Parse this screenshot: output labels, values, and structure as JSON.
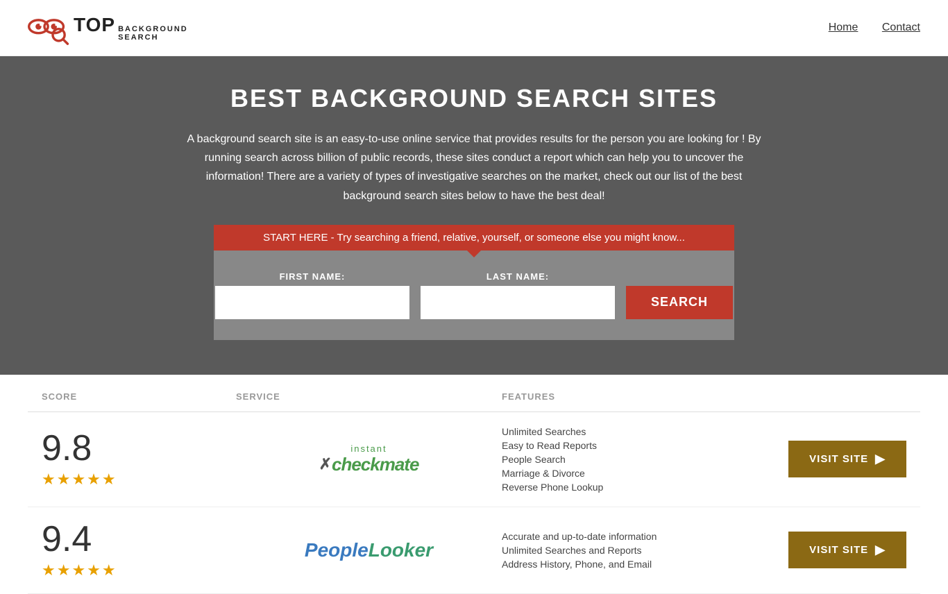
{
  "header": {
    "logo_top": "TOP",
    "logo_sub1": "BACKGROUND",
    "logo_sub2": "SEARCH",
    "nav": {
      "home": "Home",
      "contact": "Contact"
    }
  },
  "hero": {
    "title": "BEST BACKGROUND SEARCH SITES",
    "description": "A background search site is an easy-to-use online service that provides results  for the person you are looking for ! By  running  search across billion of public records, these sites conduct  a report which can help you to uncover the information! There are a variety of types of investigative searches on the market, check out our  list of the best background search sites below to have the best deal!",
    "callout": "START HERE - Try searching a friend, relative, yourself, or someone else you might know...",
    "form": {
      "first_name_label": "FIRST NAME:",
      "last_name_label": "LAST NAME:",
      "search_button": "SEARCH"
    }
  },
  "table": {
    "headers": {
      "score": "SCORE",
      "service": "SERVICE",
      "features": "FEATURES"
    },
    "rows": [
      {
        "score": "9.8",
        "stars": "★★★★★",
        "service_name": "Instant Checkmate",
        "features": [
          "Unlimited Searches",
          "Easy to Read Reports",
          "People Search",
          "Marriage & Divorce",
          "Reverse Phone Lookup"
        ],
        "visit_label": "VISIT SITE"
      },
      {
        "score": "9.4",
        "stars": "★★★★★",
        "service_name": "PeopleLooker",
        "features": [
          "Accurate and up-to-date information",
          "Unlimited Searches and Reports",
          "Address History, Phone, and Email"
        ],
        "visit_label": "VISIT SITE"
      }
    ]
  }
}
